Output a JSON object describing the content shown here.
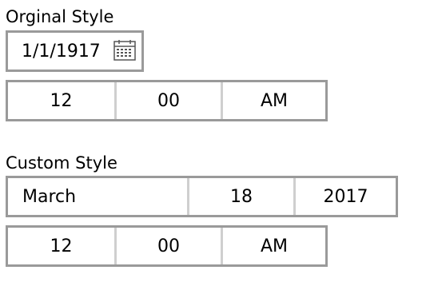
{
  "original": {
    "label": "Orginal Style",
    "date_value": "1/1/1917",
    "time": {
      "hour": "12",
      "minute": "00",
      "period": "AM"
    }
  },
  "custom": {
    "label": "Custom Style",
    "date": {
      "month": "March",
      "day": "18",
      "year": "2017"
    },
    "time": {
      "hour": "12",
      "minute": "00",
      "period": "AM"
    }
  },
  "icons": {
    "calendar": "calendar-icon"
  },
  "colors": {
    "border": "#9a9a9a",
    "separator": "#cfcfcf",
    "text": "#000000"
  }
}
